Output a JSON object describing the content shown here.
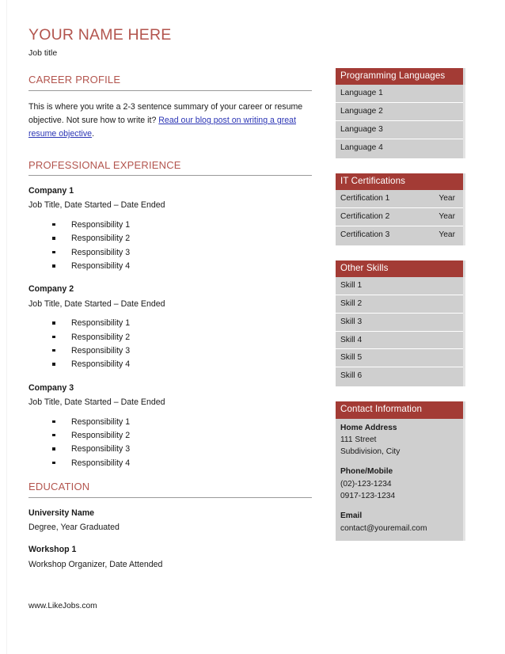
{
  "document": {
    "name": "YOUR NAME HERE",
    "job_title": "Job title",
    "footer": "www.LikeJobs.com",
    "accent_color": "#b3554e",
    "panel_header_color": "#a33b35",
    "panel_body_color": "#cfcfcf",
    "link_color": "#2b35b5"
  },
  "sections": {
    "career_profile": {
      "heading": "CAREER PROFILE",
      "text_before_link": "This is where you write a 2-3 sentence summary of your career or resume objective. Not sure how to write it? ",
      "link_text": "Read our blog post on writing a great resume objective",
      "text_after_link": "."
    },
    "professional_experience": {
      "heading": "PROFESSIONAL EXPERIENCE",
      "jobs": [
        {
          "company": "Company 1",
          "meta": "Job Title, Date Started – Date Ended",
          "responsibilities": [
            "Responsibility 1",
            "Responsibility 2",
            "Responsibility 3",
            "Responsibility 4"
          ]
        },
        {
          "company": "Company 2",
          "meta": "Job Title, Date Started – Date Ended",
          "responsibilities": [
            "Responsibility 1",
            "Responsibility 2",
            "Responsibility 3",
            "Responsibility 4"
          ]
        },
        {
          "company": "Company 3",
          "meta": "Job Title, Date Started – Date Ended",
          "responsibilities": [
            "Responsibility 1",
            "Responsibility 2",
            "Responsibility 3",
            "Responsibility 4"
          ]
        }
      ]
    },
    "education": {
      "heading": "EDUCATION",
      "entries": [
        {
          "name": "University Name",
          "meta": "Degree, Year Graduated"
        },
        {
          "name": "Workshop 1",
          "meta": "Workshop Organizer, Date Attended"
        }
      ]
    }
  },
  "sidebar": {
    "programming_languages": {
      "title": "Programming Languages",
      "rows": [
        {
          "label": "Language 1",
          "value": ""
        },
        {
          "label": "Language 2",
          "value": ""
        },
        {
          "label": "Language 3",
          "value": ""
        },
        {
          "label": "Language 4",
          "value": ""
        }
      ]
    },
    "it_certifications": {
      "title": "IT Certifications",
      "rows": [
        {
          "label": "Certification 1",
          "value": "Year"
        },
        {
          "label": "Certification 2",
          "value": "Year"
        },
        {
          "label": "Certification 3",
          "value": "Year"
        }
      ]
    },
    "other_skills": {
      "title": "Other Skills",
      "rows": [
        {
          "label": "Skill 1",
          "value": ""
        },
        {
          "label": "Skill 2",
          "value": ""
        },
        {
          "label": "Skill 3",
          "value": ""
        },
        {
          "label": "Skill 4",
          "value": ""
        },
        {
          "label": "Skill 5",
          "value": ""
        },
        {
          "label": "Skill 6",
          "value": ""
        }
      ]
    },
    "contact_information": {
      "title": "Contact Information",
      "groups": [
        {
          "label": "Home Address",
          "values": [
            "111 Street",
            "Subdivision, City"
          ]
        },
        {
          "label": "Phone/Mobile",
          "values": [
            "(02)-123-1234",
            "0917-123-1234"
          ]
        },
        {
          "label": "Email",
          "values": [
            "contact@youremail.com"
          ]
        }
      ]
    }
  }
}
